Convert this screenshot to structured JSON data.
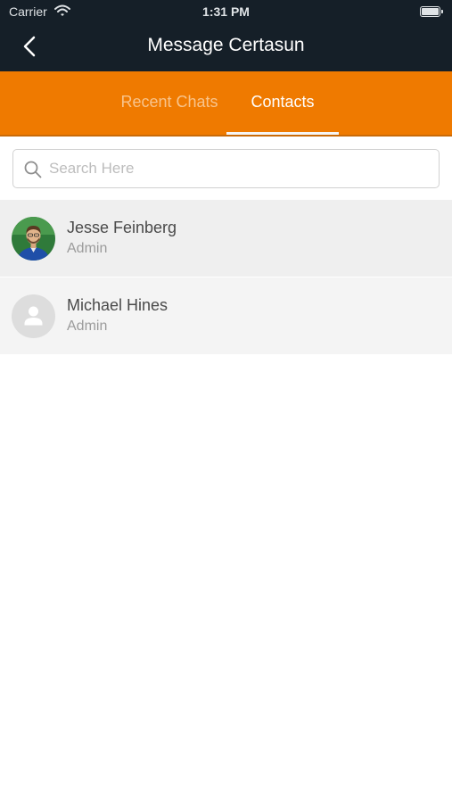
{
  "status_bar": {
    "carrier": "Carrier",
    "time": "1:31 PM"
  },
  "nav": {
    "title": "Message Certasun",
    "back_icon": "chevron-left-icon"
  },
  "tabs": [
    {
      "label": "Recent Chats",
      "active": false
    },
    {
      "label": "Contacts",
      "active": true
    }
  ],
  "search": {
    "placeholder": "Search Here",
    "value": "",
    "icon": "search-icon"
  },
  "contacts": [
    {
      "name": "Jesse Feinberg",
      "role": "Admin",
      "avatar": "photo-avatar"
    },
    {
      "name": "Michael Hines",
      "role": "Admin",
      "avatar": "default-person-avatar"
    }
  ],
  "colors": {
    "nav_background": "#151f28",
    "tab_background": "#ef7a00",
    "tab_inactive_text": "#f8c48c",
    "tab_active_text": "#ffffff"
  }
}
